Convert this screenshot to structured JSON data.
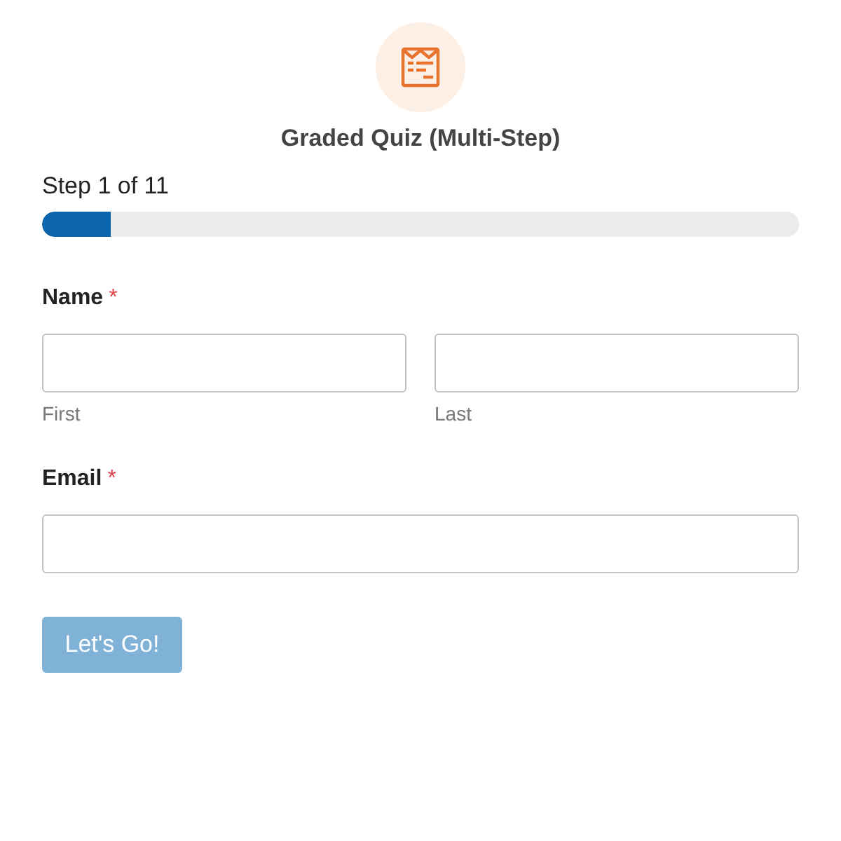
{
  "header": {
    "title": "Graded Quiz (Multi-Step)"
  },
  "progress": {
    "label": "Step 1 of 11",
    "level": 0.09
  },
  "fields": [
    {
      "kind": "split",
      "label": "Name",
      "required_mark": "*",
      "sublabels": [
        "First",
        "Last"
      ]
    },
    {
      "kind": "single",
      "label": "Email",
      "required_mark": "*"
    }
  ],
  "submit": {
    "label": "Let's Go!"
  }
}
